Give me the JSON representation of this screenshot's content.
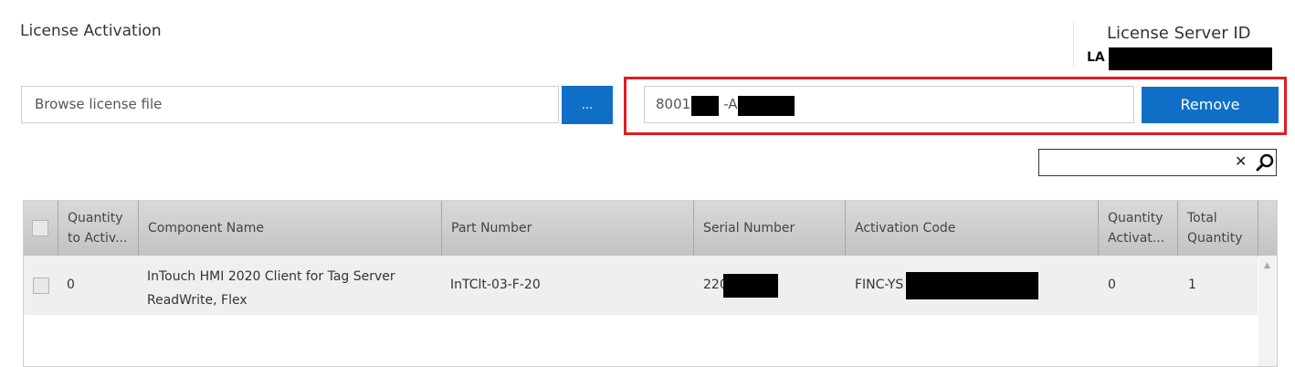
{
  "header": {
    "title": "License Activation",
    "license_server_label": "License Server ID",
    "license_server_id_prefix": "LA"
  },
  "browse": {
    "placeholder": "Browse license file",
    "button_label": "..."
  },
  "activation_code": {
    "value_visible": "8001",
    "segment_sep": "-A-"
  },
  "remove_button": "Remove",
  "search": {
    "clear_icon": "✕",
    "icon": "search-icon"
  },
  "table": {
    "columns": [
      "",
      "Quantity to Activ...",
      "Component Name",
      "Part Number",
      "Serial Number",
      "Activation Code",
      "Quantity Activat...",
      "Total Quantity"
    ],
    "rows": [
      {
        "quantity_to_activate": "0",
        "component_name": "InTouch HMI 2020 Client for Tag Server ReadWrite, Flex",
        "component_name_line1": "InTouch HMI 2020 Client for Tag Server",
        "component_name_line2": "ReadWrite, Flex",
        "part_number": "InTClt-03-F-20",
        "serial_number_prefix": "220",
        "activation_code_prefix": "FINC-YS",
        "quantity_activated": "0",
        "total_quantity": "1"
      }
    ]
  },
  "colors": {
    "accent": "#0f6fc6",
    "highlight": "#e11b22"
  }
}
